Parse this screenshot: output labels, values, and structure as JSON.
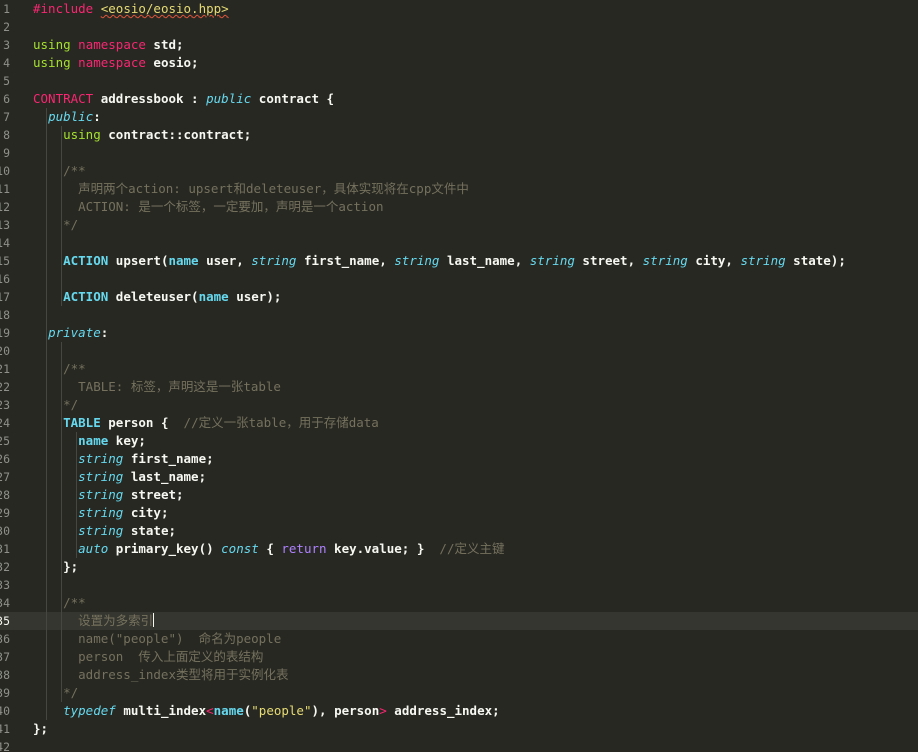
{
  "theme": {
    "background": "#272822",
    "active_line": "#35362f",
    "line_number": "#8f908a",
    "indent_guide": "#464741",
    "colors": {
      "p": "#f8f8f2",
      "kw": "#f92672",
      "macro": "#a6e22e",
      "type": "#66d9ef",
      "cmt": "#75715e",
      "fn": "#a6e22e",
      "str": "#e6db74",
      "purple": "#ae81ff",
      "paren": "#f8f8f2",
      "hdr": "#e6db74",
      "caps": "#66d9ef"
    }
  },
  "lines": [
    {
      "n": "1",
      "tokens": [
        {
          "t": "#include",
          "c": "kw"
        },
        {
          "t": " ",
          "c": "p"
        },
        {
          "t": "<eosio/eosio.hpp>",
          "c": "hdr",
          "sq": true
        }
      ]
    },
    {
      "n": "2",
      "tokens": []
    },
    {
      "n": "3",
      "tokens": [
        {
          "t": "using",
          "c": "macro"
        },
        {
          "t": " ",
          "c": "p"
        },
        {
          "t": "namespace",
          "c": "kw"
        },
        {
          "t": " std;",
          "c": "p"
        }
      ]
    },
    {
      "n": "4",
      "tokens": [
        {
          "t": "using",
          "c": "macro"
        },
        {
          "t": " ",
          "c": "p"
        },
        {
          "t": "namespace",
          "c": "kw"
        },
        {
          "t": " eosio;",
          "c": "p"
        }
      ]
    },
    {
      "n": "5",
      "tokens": []
    },
    {
      "n": "6",
      "tokens": [
        {
          "t": "CONTRACT",
          "c": "kw"
        },
        {
          "t": " addressbook : ",
          "c": "p"
        },
        {
          "t": "public",
          "c": "typei"
        },
        {
          "t": " contract {",
          "c": "p"
        }
      ]
    },
    {
      "n": "7",
      "tokens": [
        {
          "t": "  ",
          "c": "p"
        },
        {
          "t": "public",
          "c": "typei"
        },
        {
          "t": ":",
          "c": "p"
        }
      ]
    },
    {
      "n": "8",
      "tokens": [
        {
          "t": "    ",
          "c": "p"
        },
        {
          "t": "using",
          "c": "macro"
        },
        {
          "t": " contract::contract;",
          "c": "p"
        }
      ]
    },
    {
      "n": "9",
      "tokens": []
    },
    {
      "n": "10",
      "tokens": [
        {
          "t": "    /**",
          "c": "cmt"
        }
      ]
    },
    {
      "n": "11",
      "tokens": [
        {
          "t": "      声明两个action: upsert和deleteuser，具体实现将在cpp文件中",
          "c": "cmt"
        }
      ]
    },
    {
      "n": "12",
      "tokens": [
        {
          "t": "      ACTION: 是一个标签，一定要加，声明是一个action",
          "c": "cmt"
        }
      ]
    },
    {
      "n": "13",
      "tokens": [
        {
          "t": "    */",
          "c": "cmt"
        }
      ]
    },
    {
      "n": "14",
      "tokens": []
    },
    {
      "n": "15",
      "tokens": [
        {
          "t": "    ",
          "c": "p"
        },
        {
          "t": "ACTION",
          "c": "caps"
        },
        {
          "t": " upsert(",
          "c": "p"
        },
        {
          "t": "name",
          "c": "typeb"
        },
        {
          "t": " user, ",
          "c": "p"
        },
        {
          "t": "string",
          "c": "typei"
        },
        {
          "t": " first_name, ",
          "c": "p"
        },
        {
          "t": "string",
          "c": "typei"
        },
        {
          "t": " last_name, ",
          "c": "p"
        },
        {
          "t": "string",
          "c": "typei"
        },
        {
          "t": " street, ",
          "c": "p"
        },
        {
          "t": "string",
          "c": "typei"
        },
        {
          "t": " city, ",
          "c": "p"
        },
        {
          "t": "string",
          "c": "typei"
        },
        {
          "t": " state);",
          "c": "p"
        }
      ]
    },
    {
      "n": "16",
      "tokens": []
    },
    {
      "n": "17",
      "tokens": [
        {
          "t": "    ",
          "c": "p"
        },
        {
          "t": "ACTION",
          "c": "caps"
        },
        {
          "t": " deleteuser(",
          "c": "p"
        },
        {
          "t": "name",
          "c": "typeb"
        },
        {
          "t": " user);",
          "c": "p"
        }
      ]
    },
    {
      "n": "18",
      "tokens": []
    },
    {
      "n": "19",
      "tokens": [
        {
          "t": "  ",
          "c": "p"
        },
        {
          "t": "private",
          "c": "typei"
        },
        {
          "t": ":",
          "c": "p"
        }
      ]
    },
    {
      "n": "20",
      "tokens": []
    },
    {
      "n": "21",
      "tokens": [
        {
          "t": "    /**",
          "c": "cmt"
        }
      ]
    },
    {
      "n": "22",
      "tokens": [
        {
          "t": "      TABLE: 标签，声明这是一张table",
          "c": "cmt"
        }
      ]
    },
    {
      "n": "23",
      "tokens": [
        {
          "t": "    */",
          "c": "cmt"
        }
      ]
    },
    {
      "n": "24",
      "tokens": [
        {
          "t": "    ",
          "c": "p"
        },
        {
          "t": "TABLE",
          "c": "caps"
        },
        {
          "t": " person {  ",
          "c": "p"
        },
        {
          "t": "//定义一张table，用于存储data",
          "c": "cmt"
        }
      ]
    },
    {
      "n": "25",
      "tokens": [
        {
          "t": "      ",
          "c": "p"
        },
        {
          "t": "name",
          "c": "typeb"
        },
        {
          "t": " key;",
          "c": "p"
        }
      ]
    },
    {
      "n": "26",
      "tokens": [
        {
          "t": "      ",
          "c": "p"
        },
        {
          "t": "string",
          "c": "typei"
        },
        {
          "t": " first_name;",
          "c": "p"
        }
      ]
    },
    {
      "n": "27",
      "tokens": [
        {
          "t": "      ",
          "c": "p"
        },
        {
          "t": "string",
          "c": "typei"
        },
        {
          "t": " last_name;",
          "c": "p"
        }
      ]
    },
    {
      "n": "28",
      "tokens": [
        {
          "t": "      ",
          "c": "p"
        },
        {
          "t": "string",
          "c": "typei"
        },
        {
          "t": " street;",
          "c": "p"
        }
      ]
    },
    {
      "n": "29",
      "tokens": [
        {
          "t": "      ",
          "c": "p"
        },
        {
          "t": "string",
          "c": "typei"
        },
        {
          "t": " city;",
          "c": "p"
        }
      ]
    },
    {
      "n": "30",
      "tokens": [
        {
          "t": "      ",
          "c": "p"
        },
        {
          "t": "string",
          "c": "typei"
        },
        {
          "t": " state;",
          "c": "p"
        }
      ]
    },
    {
      "n": "31",
      "tokens": [
        {
          "t": "      ",
          "c": "p"
        },
        {
          "t": "auto",
          "c": "typei"
        },
        {
          "t": " primary_key() ",
          "c": "p"
        },
        {
          "t": "const",
          "c": "typei"
        },
        {
          "t": " { ",
          "c": "p"
        },
        {
          "t": "return",
          "c": "purple"
        },
        {
          "t": " key.value; }  ",
          "c": "p"
        },
        {
          "t": "//定义主键",
          "c": "cmt"
        }
      ]
    },
    {
      "n": "32",
      "tokens": [
        {
          "t": "    };",
          "c": "p"
        }
      ]
    },
    {
      "n": "33",
      "tokens": []
    },
    {
      "n": "34",
      "tokens": [
        {
          "t": "    /**",
          "c": "cmt"
        }
      ]
    },
    {
      "n": "35",
      "active": true,
      "tokens": [
        {
          "t": "      设置为多索引",
          "c": "cmt"
        },
        {
          "cursor": true
        }
      ]
    },
    {
      "n": "36",
      "tokens": [
        {
          "t": "      name(\"people\")  命名为people",
          "c": "cmt"
        }
      ]
    },
    {
      "n": "37",
      "tokens": [
        {
          "t": "      person  传入上面定义的表结构",
          "c": "cmt"
        }
      ]
    },
    {
      "n": "38",
      "tokens": [
        {
          "t": "      address_index类型将用于实例化表",
          "c": "cmt"
        }
      ]
    },
    {
      "n": "39",
      "tokens": [
        {
          "t": "    */",
          "c": "cmt"
        }
      ]
    },
    {
      "n": "40",
      "tokens": [
        {
          "t": "    ",
          "c": "p"
        },
        {
          "t": "typedef",
          "c": "typei"
        },
        {
          "t": " multi_index",
          "c": "p"
        },
        {
          "t": "<",
          "c": "kw"
        },
        {
          "t": "name",
          "c": "typeb"
        },
        {
          "t": "(",
          "c": "p"
        },
        {
          "t": "\"people\"",
          "c": "str"
        },
        {
          "t": "), person",
          "c": "p"
        },
        {
          "t": ">",
          "c": "kw"
        },
        {
          "t": " address_index;",
          "c": "p"
        }
      ]
    },
    {
      "n": "41",
      "tokens": [
        {
          "t": "};",
          "c": "p"
        }
      ]
    },
    {
      "n": "42",
      "tokens": []
    }
  ]
}
